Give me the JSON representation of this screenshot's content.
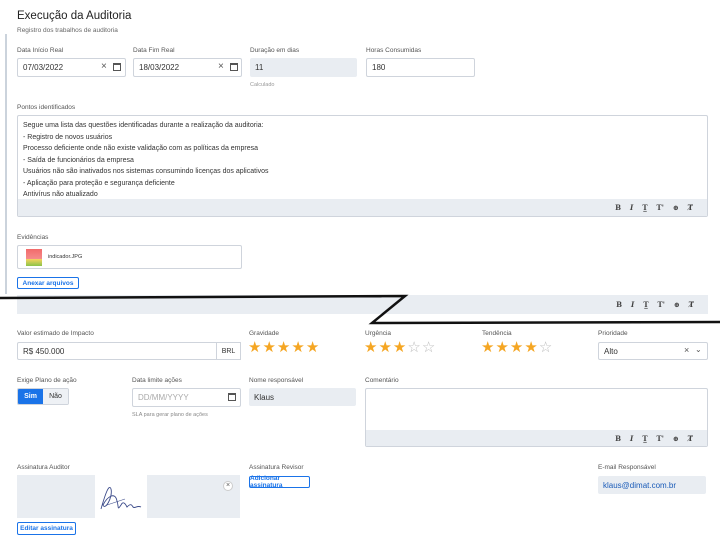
{
  "header": {
    "title": "Execução da Auditoria",
    "subtitle": "Registro dos trabalhos de auditoria"
  },
  "dates": {
    "start_label": "Data Início Real",
    "start_value": "07/03/2022",
    "end_label": "Data Fim Real",
    "end_value": "18/03/2022",
    "duration_label": "Duração em dias",
    "duration_value": "11",
    "duration_hint": "Calculado",
    "hours_label": "Horas Consumidas",
    "hours_value": "180",
    "clear_glyph": "×",
    "calendar_icon": "calendar-icon"
  },
  "points": {
    "label": "Pontos identificados",
    "lines": [
      "Segue uma lista das questões identificadas durante a realização da auditoria:",
      "- Registro de novos usuários",
      "Processo deficiente onde não existe validação com as políticas da empresa",
      "- Saída de funcionários da empresa",
      "Usuários não são inativados nos sistemas consumindo licenças dos aplicativos",
      "- Aplicação para proteção e segurança deficiente",
      "Antivírus não atualizado"
    ]
  },
  "toolbar": {
    "bold": "B",
    "italic": "I",
    "clear": "T̲",
    "size": "T'",
    "link": "⊕",
    "remove": "T̸"
  },
  "evidence": {
    "label": "Evidências",
    "file_name": "indicador.JPG",
    "attach_label": "Anexar arquivos"
  },
  "impact": {
    "value_label": "Valor estimado de Impacto",
    "value": "R$ 450.000",
    "currency": "BRL",
    "gravity_label": "Gravidade",
    "gravity_rating": 5,
    "urgency_label": "Urgência",
    "urgency_rating": 3,
    "trend_label": "Tendência",
    "trend_rating": 4,
    "priority_label": "Prioridade",
    "priority_value": "Alto",
    "star_color": "#f5a623"
  },
  "plan": {
    "label": "Exige Plano de ação",
    "yes": "Sim",
    "no": "Não",
    "limit_label": "Data limite ações",
    "limit_placeholder": "DD/MM/YYYY",
    "limit_hint": "SLA para gerar plano de ações",
    "responsible_label": "Nome responsável",
    "responsible_value": "Klaus",
    "comment_label": "Comentário"
  },
  "signatures": {
    "auditor_label": "Assinatura Auditor",
    "edit_label": "Editar assinatura",
    "reviewer_label": "Assinatura Revisor",
    "add_label": "Adicionar assinatura",
    "email_label": "E-mail Responsável",
    "email_value": "klaus@dimat.com.br"
  },
  "colors": {
    "accent": "#1a73e8",
    "readonly_bg": "#e9edf2"
  }
}
